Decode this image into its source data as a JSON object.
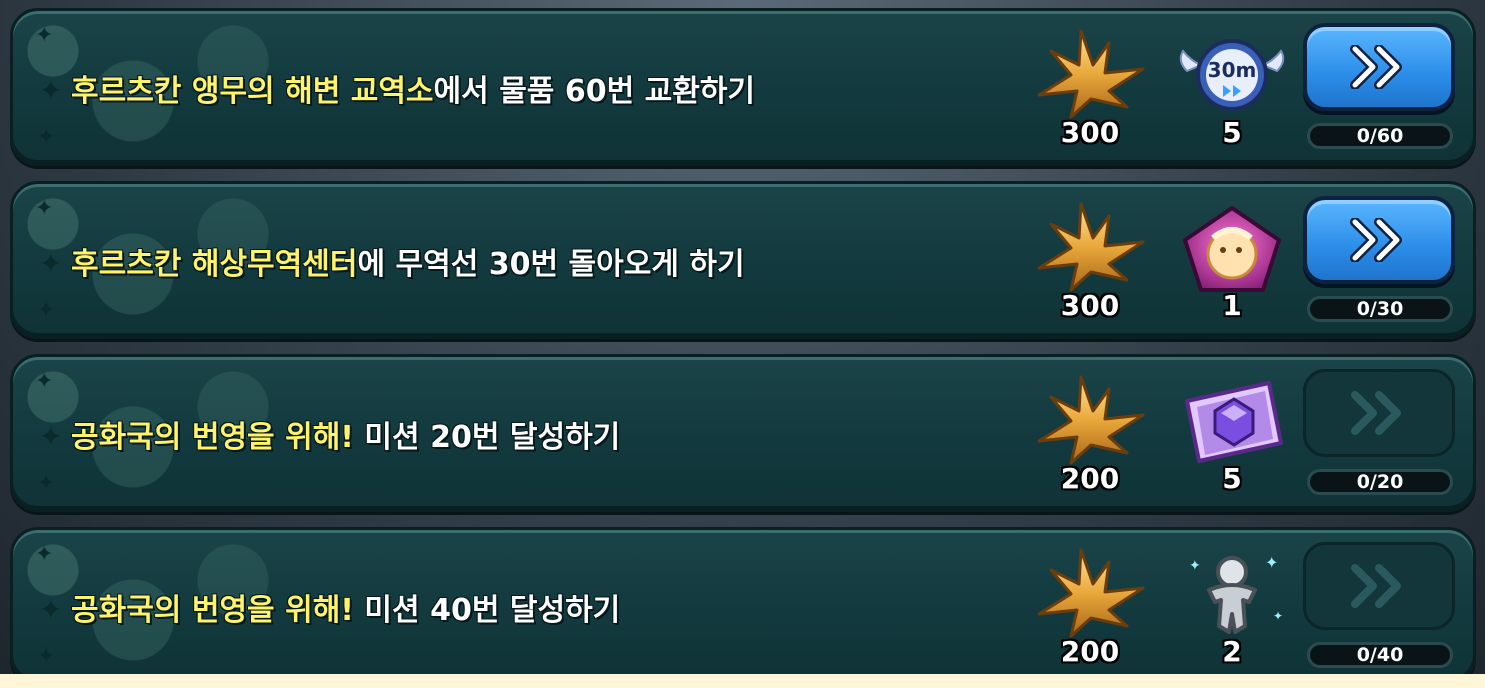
{
  "missions": [
    {
      "title_highlight": "후르츠칸 앵무의 해변 교역소",
      "title_rest": "에서 물품 60번 교환하기",
      "gold_amount": "300",
      "item_icon": "30m-speedup-clock-icon",
      "item_badge": "30m",
      "item_amount": "5",
      "button_enabled": true,
      "progress_text": "0/60",
      "progress_fraction": 0
    },
    {
      "title_highlight": "후르츠칸 해상무역센터",
      "title_rest": "에 무역선 30번 돌아오게 하기",
      "gold_amount": "300",
      "item_icon": "cookie-soulstone-icon",
      "item_badge": "",
      "item_amount": "1",
      "button_enabled": true,
      "progress_text": "0/30",
      "progress_fraction": 0
    },
    {
      "title_highlight": "공화국의 번영을 위해!",
      "title_rest": " 미션 20번 달성하기",
      "gold_amount": "200",
      "item_icon": "crystal-ticket-icon",
      "item_badge": "",
      "item_amount": "5",
      "button_enabled": false,
      "progress_text": "0/20",
      "progress_fraction": 0
    },
    {
      "title_highlight": "공화국의 번영을 위해!",
      "title_rest": " 미션 40번 달성하기",
      "gold_amount": "200",
      "item_icon": "silver-cookie-cutter-icon",
      "item_badge": "",
      "item_amount": "2",
      "button_enabled": false,
      "progress_text": "0/40",
      "progress_fraction": 0
    }
  ],
  "icons": {
    "reward_gold": "gold-leaf-icon",
    "go": "double-chevron-right-icon",
    "sparkle": "sparkle-icon"
  },
  "colors": {
    "highlight": "#fff36b",
    "button_blue": "#2b8de8",
    "card_bg": "#123a3e",
    "gold": "#e9a83a"
  }
}
